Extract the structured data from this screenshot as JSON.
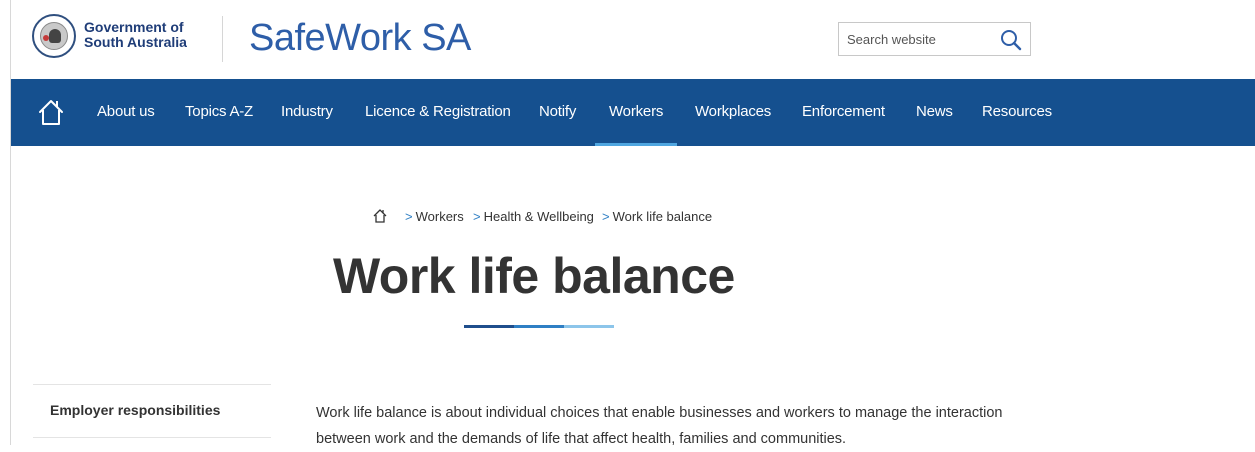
{
  "header": {
    "gov_line1": "Government of",
    "gov_line2": "South Australia",
    "site_title": "SafeWork SA",
    "search": {
      "placeholder": "Search website",
      "value": ""
    }
  },
  "nav": {
    "items": [
      {
        "label": "About us"
      },
      {
        "label": "Topics A-Z"
      },
      {
        "label": "Industry"
      },
      {
        "label": "Licence & Registration"
      },
      {
        "label": "Notify"
      },
      {
        "label": "Workers",
        "active": true
      },
      {
        "label": "Workplaces"
      },
      {
        "label": "Enforcement"
      },
      {
        "label": "News"
      },
      {
        "label": "Resources"
      }
    ]
  },
  "breadcrumb": {
    "separator": ">",
    "items": [
      "Workers",
      "Health & Wellbeing",
      "Work life balance"
    ]
  },
  "page": {
    "title": "Work life balance",
    "intro": "Work life balance is about individual choices that enable businesses and workers to manage the interaction between work and the demands of life that affect health, families and communities."
  },
  "sidebar": {
    "items": [
      {
        "label": "Employer responsibilities"
      }
    ]
  },
  "colors": {
    "nav_bg": "#15508f",
    "brand_blue": "#2e5ea8",
    "gov_blue": "#1f3d78",
    "active_underline": "#4fa6e0",
    "text": "#333333"
  },
  "icons": [
    "sa-government-crest-icon",
    "search-icon",
    "home-icon",
    "breadcrumb-home-icon"
  ]
}
